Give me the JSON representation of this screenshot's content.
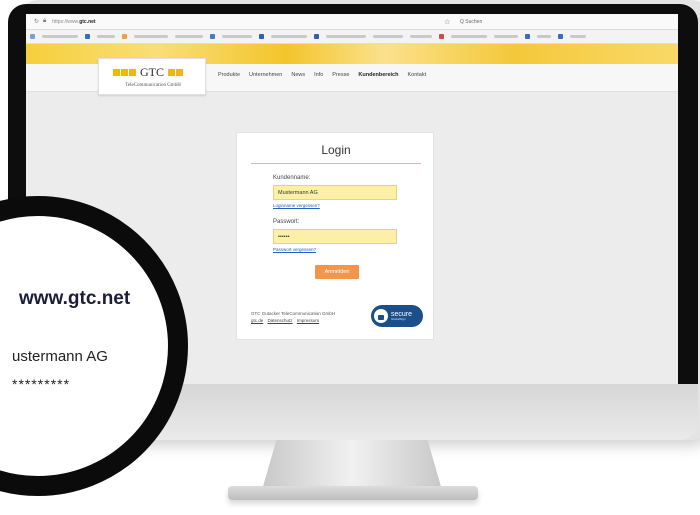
{
  "browser": {
    "url_prefix": "https://www.",
    "url_domain": "gtc.net",
    "search_placeholder": "Q  Suchen"
  },
  "site": {
    "logo_text": "GTC",
    "logo_subtitle": "TeleCommunication GmbH",
    "menu": [
      "Produkte",
      "Unternehmen",
      "News",
      "Info",
      "Presse",
      "Kundenbereich",
      "Kontakt"
    ],
    "active_menu": "Kundenbereich"
  },
  "login": {
    "title": "Login",
    "username_label": "Kundenname:",
    "username_value": "Mustermann AG",
    "username_forgot": "Loginname vergessen?",
    "password_label": "Passwort:",
    "password_value": "••••••",
    "password_forgot": "Passwort vergessen?",
    "submit_label": "Anmelden",
    "company_name": "GTC Gutacker TeleCommunication GmbH",
    "footer_links": [
      "gtc.de",
      "Datenschutz",
      "Impressum"
    ],
    "secure_badge": "secure",
    "secure_badge_sub": "GlobalSign"
  },
  "magnifier": {
    "url": "www.gtc.net",
    "username": "ustermann AG",
    "password": "*********"
  },
  "colors": {
    "accent_orange": "#f4954b",
    "field_yellow": "#fcf0a8",
    "brand_yellow": "#f2b705",
    "badge_blue": "#1b4f8a"
  }
}
